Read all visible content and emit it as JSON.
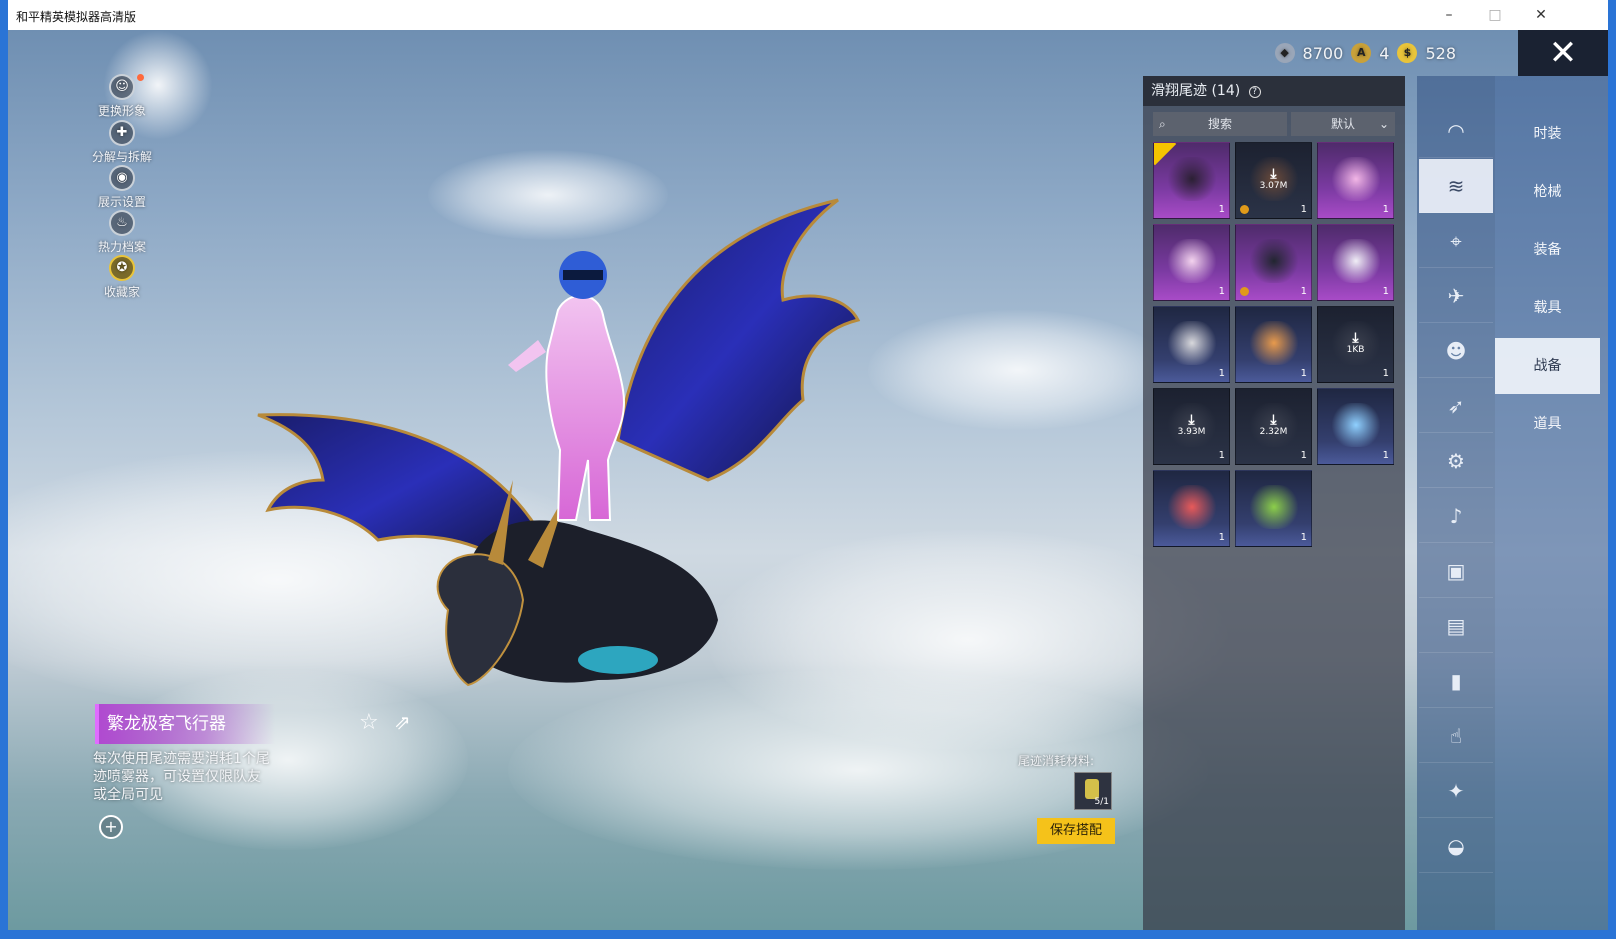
{
  "window": {
    "title": "和平精英模拟器高清版",
    "minimize": "–",
    "maximize": "□",
    "close": "✕"
  },
  "left_menu": [
    {
      "label": "更换形象",
      "icon": "avatar-icon",
      "glyph": "☺"
    },
    {
      "label": "分解与拆解",
      "icon": "dismantle-icon",
      "glyph": "✚"
    },
    {
      "label": "展示设置",
      "icon": "eye-icon",
      "glyph": "◉"
    },
    {
      "label": "热力档案",
      "icon": "flame-icon",
      "glyph": "♨"
    },
    {
      "label": "收藏家",
      "icon": "collector-badge-icon",
      "glyph": "✪"
    }
  ],
  "currency": [
    {
      "value": "8700",
      "icon": "silver-coin-icon",
      "color": "#9aa6b8"
    },
    {
      "value": "4",
      "icon": "a-coin-icon",
      "color": "#c9a13a"
    },
    {
      "value": "528",
      "icon": "gold-coin-icon",
      "color": "#e9c43a"
    }
  ],
  "close_glyph": "✕",
  "panel": {
    "title": "滑翔尾迹 (14)",
    "help_glyph": "?",
    "search_placeholder": "搜索",
    "search_glyph": "⌕",
    "sort_label": "默认",
    "sort_glyph": "⌄"
  },
  "tiles": [
    {
      "style": "purple",
      "art": "#2b2033",
      "count": "1",
      "selected": true,
      "badge": false,
      "download": null
    },
    {
      "style": "dark",
      "art": "#6a4a3a",
      "count": "1",
      "selected": false,
      "badge": true,
      "download": "3.07M"
    },
    {
      "style": "purple",
      "art": "#f2b6e6",
      "count": "1",
      "selected": false,
      "badge": false,
      "download": null
    },
    {
      "style": "purple",
      "art": "#f3d3ee",
      "count": "1",
      "selected": false,
      "badge": false,
      "download": null
    },
    {
      "style": "purple",
      "art": "#222630",
      "count": "1",
      "selected": false,
      "badge": true,
      "download": null
    },
    {
      "style": "purple",
      "art": "#f0eef6",
      "count": "1",
      "selected": false,
      "badge": false,
      "download": null
    },
    {
      "style": "blue",
      "art": "#d8d8dc",
      "count": "1",
      "selected": false,
      "badge": false,
      "download": null
    },
    {
      "style": "blue",
      "art": "#e89a4c",
      "count": "1",
      "selected": false,
      "badge": false,
      "download": null
    },
    {
      "style": "dark",
      "art": "#3a3f4d",
      "count": "1",
      "selected": false,
      "badge": false,
      "download": "1KB"
    },
    {
      "style": "dark",
      "art": "#3a3f4d",
      "count": "1",
      "selected": false,
      "badge": false,
      "download": "3.93M"
    },
    {
      "style": "dark",
      "art": "#3a3f4d",
      "count": "1",
      "selected": false,
      "badge": false,
      "download": "2.32M"
    },
    {
      "style": "blue",
      "art": "#8fd0ff",
      "count": "1",
      "selected": false,
      "badge": false,
      "download": null
    },
    {
      "style": "blue",
      "art": "#e85a5a",
      "count": "1",
      "selected": false,
      "badge": false,
      "download": null
    },
    {
      "style": "blue",
      "art": "#8ccf4a",
      "count": "1",
      "selected": false,
      "badge": false,
      "download": null
    }
  ],
  "side_icons": [
    {
      "icon": "parachute-icon",
      "glyph": "◠",
      "active": false
    },
    {
      "icon": "glide-trail-icon",
      "glyph": "≋",
      "active": true
    },
    {
      "icon": "drone-icon",
      "glyph": "⌖",
      "active": false
    },
    {
      "icon": "plane-icon",
      "glyph": "✈",
      "active": false
    },
    {
      "icon": "emote-face-icon",
      "glyph": "☻",
      "active": false
    },
    {
      "icon": "jet-icon",
      "glyph": "➶",
      "active": false
    },
    {
      "icon": "robot-icon",
      "glyph": "⚙",
      "active": false
    },
    {
      "icon": "speaker-icon",
      "glyph": "♪",
      "active": false
    },
    {
      "icon": "pet-icon",
      "glyph": "▣",
      "active": false
    },
    {
      "icon": "gallery-icon",
      "glyph": "▤",
      "active": false
    },
    {
      "icon": "spray-can-icon",
      "glyph": "▮",
      "active": false
    },
    {
      "icon": "hand-tap-icon",
      "glyph": "☝",
      "active": false
    },
    {
      "icon": "sparkle-wand-icon",
      "glyph": "✦",
      "active": false
    },
    {
      "icon": "airdrop-icon",
      "glyph": "◒",
      "active": false
    }
  ],
  "categories": [
    {
      "label": "时装",
      "active": false
    },
    {
      "label": "枪械",
      "active": false
    },
    {
      "label": "装备",
      "active": false
    },
    {
      "label": "载具",
      "active": false
    },
    {
      "label": "战备",
      "active": true
    },
    {
      "label": "道具",
      "active": false
    }
  ],
  "item": {
    "name": "繁龙极客飞行器",
    "description": "每次使用尾迹需要消耗1个尾迹喷雾器，可设置仅限队友或全局可见",
    "star_glyph": "☆",
    "share_glyph": "⇗",
    "zoom_glyph": "+"
  },
  "material": {
    "label": "尾迹消耗材料:",
    "count": "5/1"
  },
  "save_label": "保存搭配"
}
